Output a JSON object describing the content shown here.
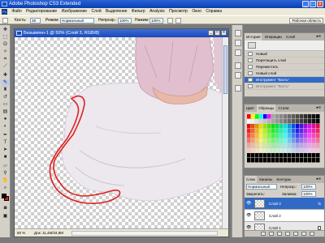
{
  "window": {
    "title": "Adobe Photoshop CS3 Extended",
    "controls": [
      "_",
      "□",
      "x"
    ]
  },
  "menu": [
    "Файл",
    "Редактирование",
    "Изображение",
    "Слой",
    "Выделение",
    "Фильтр",
    "Analysis",
    "Просмотр",
    "Окно",
    "Справка"
  ],
  "options_bar": {
    "brush_label": "Кисть:",
    "brush_size": "38",
    "mode_label": "Режим:",
    "mode_value": "Нормальный",
    "opacity_label": "Непрозр.:",
    "opacity_value": "100%",
    "flow_label": "Нажим:",
    "flow_value": "100%",
    "workspace_label": "Рабочая область"
  },
  "document": {
    "title": "Безымянн-1 @ 50% (Слой 3, RGB/8)",
    "zoom": "50 %",
    "doc_info": "Док: 11,4М/34,8М",
    "stroke_color": "#e02020"
  },
  "history_panel": {
    "tabs": [
      "История",
      "Операции",
      "Слой"
    ],
    "items": [
      {
        "label": "Новый"
      },
      {
        "label": "Перетащить слой"
      },
      {
        "label": "Переместить"
      },
      {
        "label": "Новый слой"
      },
      {
        "label": "Инструмент \"Кисть\""
      },
      {
        "label": "Инструмент \"Кисть\""
      }
    ]
  },
  "swatch_panel": {
    "tabs": [
      "Цвет",
      "Образцы",
      "Стили"
    ]
  },
  "layers_panel": {
    "tabs": [
      "Слои",
      "Каналы",
      "Контуры"
    ],
    "blend_mode": "Нормальный",
    "opacity_label": "Непрозр.:",
    "opacity_value": "100%",
    "lock_label": "Закрепить:",
    "fill_label": "Заливка:",
    "fill_value": "100%",
    "layers": [
      {
        "name": "Слой 3",
        "fx": "fx"
      },
      {
        "name": "Слой 2"
      },
      {
        "name": "Слой 1"
      }
    ]
  }
}
